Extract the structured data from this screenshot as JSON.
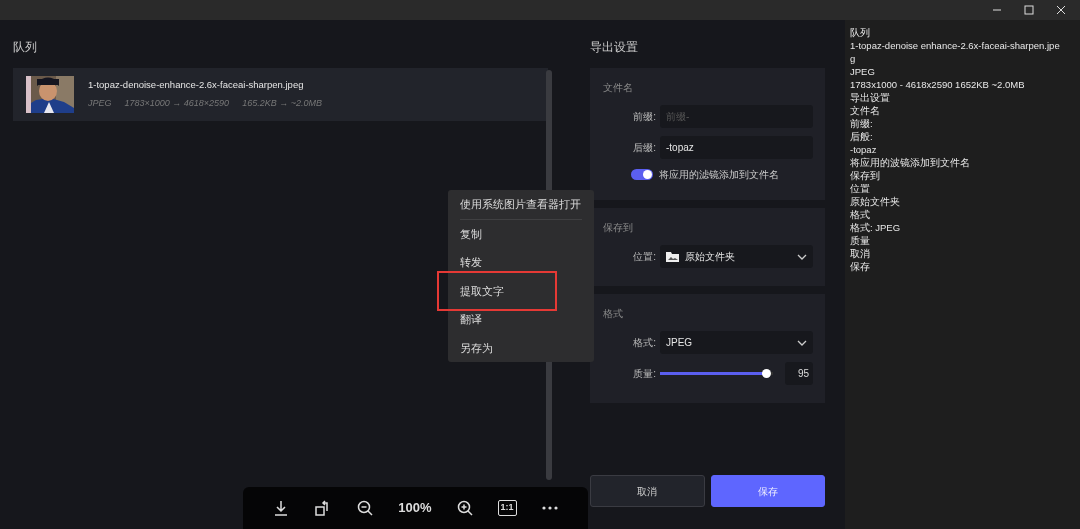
{
  "queue": {
    "title": "队列",
    "items": [
      {
        "name": "1-topaz-denoise-enhance-2.6x-faceai-sharpen.jpeg",
        "format": "JPEG",
        "dimensions": "1783×1000 → 4618×2590",
        "size": "165.2KB → ~2.0MB"
      }
    ]
  },
  "context_menu": {
    "items": [
      {
        "label": "使用系统图片查看器打开",
        "separator": true,
        "highlighted": false
      },
      {
        "label": "复制",
        "separator": false,
        "highlighted": false
      },
      {
        "label": "转发",
        "separator": false,
        "highlighted": false
      },
      {
        "label": "提取文字",
        "separator": false,
        "highlighted": true
      },
      {
        "label": "翻译",
        "separator": false,
        "highlighted": false
      },
      {
        "label": "另存为",
        "separator": false,
        "highlighted": false
      }
    ]
  },
  "export": {
    "title": "导出设置",
    "filename": {
      "title": "文件名",
      "prefix": {
        "label": "前缀:",
        "placeholder": "前缀-"
      },
      "suffix": {
        "label": "后缀:",
        "value": "-topaz"
      },
      "toggle": {
        "label": "将应用的滤镜添加到文件名",
        "on": true
      }
    },
    "save_to": {
      "title": "保存到",
      "location": {
        "label": "位置:",
        "value": "原始文件夹"
      }
    },
    "format": {
      "title": "格式",
      "format": {
        "label": "格式:",
        "value": "JPEG"
      },
      "quality": {
        "label": "质量:",
        "level": 0.95,
        "value": "95"
      }
    },
    "buttons": [
      {
        "label": "取消",
        "primary": false
      },
      {
        "label": "保存",
        "primary": true
      }
    ]
  },
  "toolbar": {
    "zoom": "100%",
    "actual_size": "1:1"
  },
  "ocr_panel": {
    "lines": [
      "队列",
      "1-topaz-denoise enhance-2.6x-faceai-sharpen.jpe",
      "g",
      "JPEG",
      "1783x1000 - 4618x2590 1652KB ~2.0MB",
      "导出设置",
      "文件名",
      "前缀:",
      "后般:",
      "-topaz",
      "将应用的波镜添加到文件名",
      "保存到",
      "位置",
      "原始文件夹",
      "格式",
      "格式: JPEG",
      "质量",
      "取消",
      "保存"
    ]
  }
}
